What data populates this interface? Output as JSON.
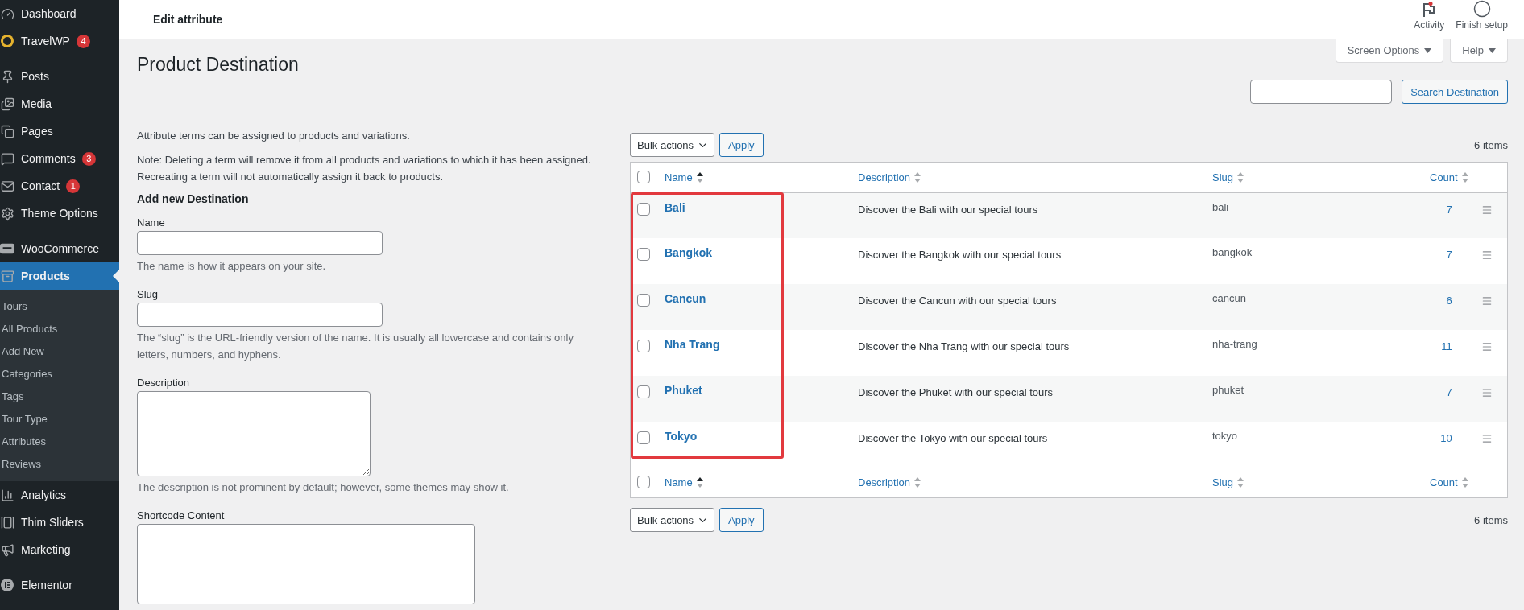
{
  "header": {
    "title": "Edit attribute",
    "actions": [
      {
        "label": "Activity",
        "kind": "activity",
        "notification": true
      },
      {
        "label": "Finish setup",
        "kind": "setup",
        "notification": false
      }
    ]
  },
  "sidebar": {
    "groups": [
      [
        {
          "label": "Dashboard",
          "selected": false
        },
        {
          "label": "TravelWP",
          "badge": "4",
          "selected": false
        }
      ],
      [
        {
          "label": "Posts",
          "selected": false
        },
        {
          "label": "Media",
          "selected": false
        },
        {
          "label": "Pages",
          "selected": false
        },
        {
          "label": "Comments",
          "badge": "3",
          "selected": false
        },
        {
          "label": "Contact",
          "badge": "1",
          "selected": false
        },
        {
          "label": "Theme Options",
          "selected": false
        }
      ],
      [
        {
          "label": "WooCommerce",
          "selected": false
        },
        {
          "label": "Products",
          "selected": true,
          "children": [
            {
              "label": "Tours",
              "selected": false
            },
            {
              "label": "All Products",
              "selected": false
            },
            {
              "label": "Add New",
              "selected": false
            },
            {
              "label": "Categories",
              "selected": false
            },
            {
              "label": "Tags",
              "selected": false
            },
            {
              "label": "Tour Type",
              "selected": false
            },
            {
              "label": "Attributes",
              "selected": false
            },
            {
              "label": "Reviews",
              "selected": false
            }
          ]
        },
        {
          "label": "Analytics",
          "selected": false
        },
        {
          "label": "Thim Sliders",
          "selected": false
        },
        {
          "label": "Marketing",
          "selected": false
        }
      ],
      [
        {
          "label": "Elementor",
          "selected": false
        }
      ]
    ]
  },
  "screen_meta": [
    {
      "label": "Screen Options"
    },
    {
      "label": "Help"
    }
  ],
  "page_title": "Product Destination",
  "search": {
    "button": "Search Destination"
  },
  "form": {
    "intro": "Attribute terms can be assigned to products and variations.",
    "note": "Note: Deleting a term will remove it from all products and variations to which it has been assigned. Recreating a term will not automatically assign it back to products.",
    "heading": "Add new Destination",
    "fields": [
      {
        "label": "Name",
        "kind": "input",
        "help": "The name is how it appears on your site."
      },
      {
        "label": "Slug",
        "kind": "input",
        "help": "The “slug” is the URL-friendly version of the name. It is usually all lowercase and contains only letters, numbers, and hyphens."
      },
      {
        "label": "Description",
        "kind": "textarea",
        "help": "The description is not prominent by default; however, some themes may show it."
      },
      {
        "label": "Shortcode Content",
        "kind": "bigtextarea"
      }
    ]
  },
  "tablenav_top": {
    "bulk": "Bulk actions",
    "apply": "Apply",
    "count": "6 items"
  },
  "table": {
    "header_checked": false,
    "columns": [
      {
        "label": "Name",
        "sorted": true
      },
      {
        "label": "Description",
        "sorted": false
      },
      {
        "label": "Slug",
        "sorted": false
      },
      {
        "label": "Count",
        "sorted": false
      }
    ],
    "rows": [
      {
        "name": "Bali",
        "description": "Discover the Bali with our special tours",
        "slug": "bali",
        "count": "7",
        "checked": false
      },
      {
        "name": "Bangkok",
        "description": "Discover the Bangkok with our special tours",
        "slug": "bangkok",
        "count": "7",
        "checked": false
      },
      {
        "name": "Cancun",
        "description": "Discover the Cancun with our special tours",
        "slug": "cancun",
        "count": "6",
        "checked": false
      },
      {
        "name": "Nha Trang",
        "description": "Discover the Nha Trang with our special tours",
        "slug": "nha-trang",
        "count": "11",
        "checked": false
      },
      {
        "name": "Phuket",
        "description": "Discover the Phuket with our special tours",
        "slug": "phuket",
        "count": "7",
        "checked": false
      },
      {
        "name": "Tokyo",
        "description": "Discover the Tokyo with our special tours",
        "slug": "tokyo",
        "count": "10",
        "checked": false
      }
    ],
    "footer_checked": false,
    "footer_columns": [
      {
        "label": "Name",
        "sorted": true
      },
      {
        "label": "Description",
        "sorted": false
      },
      {
        "label": "Slug",
        "sorted": false
      },
      {
        "label": "Count",
        "sorted": false
      }
    ]
  },
  "tablenav_bottom": {
    "bulk": "Bulk actions",
    "apply": "Apply",
    "count": "6 items"
  }
}
